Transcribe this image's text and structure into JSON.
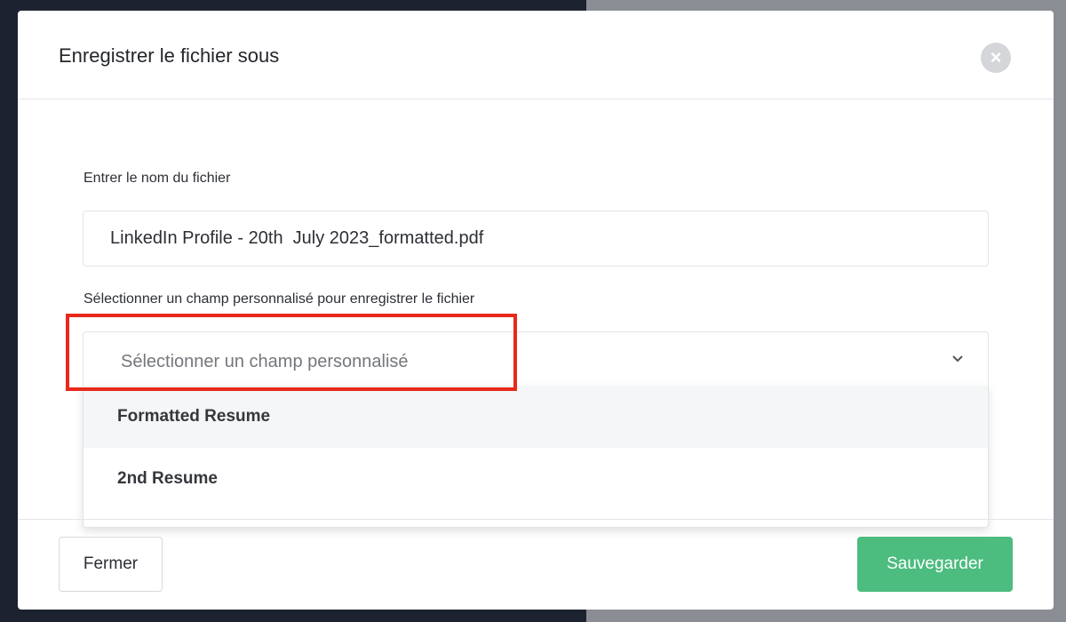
{
  "dialog": {
    "title": "Enregistrer le fichier sous",
    "close_symbol": "×"
  },
  "file_name": {
    "label": "Entrer le nom du fichier",
    "value": "LinkedIn Profile - 20th  July 2023_formatted.pdf"
  },
  "custom_field": {
    "label": "Sélectionner un champ personnalisé pour enregistrer le fichier",
    "placeholder": "Sélectionner un champ personnalisé",
    "options": [
      {
        "label": "Formatted Resume"
      },
      {
        "label": "2nd Resume"
      }
    ]
  },
  "footer": {
    "close_label": "Fermer",
    "save_label": "Sauvegarder"
  },
  "colors": {
    "save_button": "#4cbc7f",
    "highlight_border": "#e8291c",
    "close_icon_bg": "#d4d6d9"
  },
  "icons": {
    "close": "close-icon",
    "dropdown": "chevron-down-icon"
  }
}
